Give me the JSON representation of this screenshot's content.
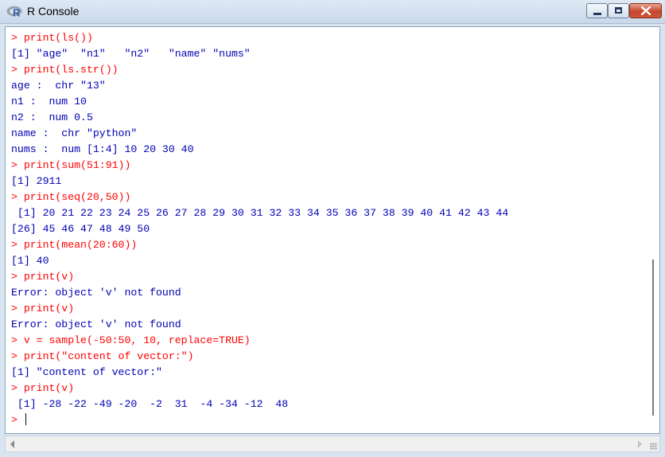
{
  "window": {
    "title": "R Console",
    "accent_color": "#2a5d9f",
    "close_color": "#c4452b"
  },
  "titlebar_icons": [
    "r-logo-icon",
    "minimize-icon",
    "maximize-icon",
    "close-icon"
  ],
  "console": {
    "input_color": "#ff0000",
    "output_color": "#0000b4",
    "lines": [
      {
        "kind": "input",
        "text": "> print(ls())"
      },
      {
        "kind": "output",
        "text": "[1] \"age\"  \"n1\"   \"n2\"   \"name\" \"nums\""
      },
      {
        "kind": "input",
        "text": "> print(ls.str())"
      },
      {
        "kind": "output",
        "text": "age :  chr \"13\""
      },
      {
        "kind": "output",
        "text": "n1 :  num 10"
      },
      {
        "kind": "output",
        "text": "n2 :  num 0.5"
      },
      {
        "kind": "output",
        "text": "name :  chr \"python\""
      },
      {
        "kind": "output",
        "text": "nums :  num [1:4] 10 20 30 40"
      },
      {
        "kind": "input",
        "text": "> print(sum(51:91))"
      },
      {
        "kind": "output",
        "text": "[1] 2911"
      },
      {
        "kind": "input",
        "text": "> print(seq(20,50))"
      },
      {
        "kind": "output",
        "text": " [1] 20 21 22 23 24 25 26 27 28 29 30 31 32 33 34 35 36 37 38 39 40 41 42 43 44"
      },
      {
        "kind": "output",
        "text": "[26] 45 46 47 48 49 50"
      },
      {
        "kind": "input",
        "text": "> print(mean(20:60))"
      },
      {
        "kind": "output",
        "text": "[1] 40"
      },
      {
        "kind": "input",
        "text": "> print(v)"
      },
      {
        "kind": "output",
        "text": "Error: object 'v' not found"
      },
      {
        "kind": "input",
        "text": "> print(v)"
      },
      {
        "kind": "output",
        "text": "Error: object 'v' not found"
      },
      {
        "kind": "input",
        "text": "> v = sample(-50:50, 10, replace=TRUE)"
      },
      {
        "kind": "input",
        "text": "> print(\"content of vector:\")"
      },
      {
        "kind": "output",
        "text": "[1] \"content of vector:\""
      },
      {
        "kind": "input",
        "text": "> print(v)"
      },
      {
        "kind": "output",
        "text": " [1] -28 -22 -49 -20  -2  31  -4 -34 -12  48"
      }
    ],
    "prompt": "> "
  }
}
